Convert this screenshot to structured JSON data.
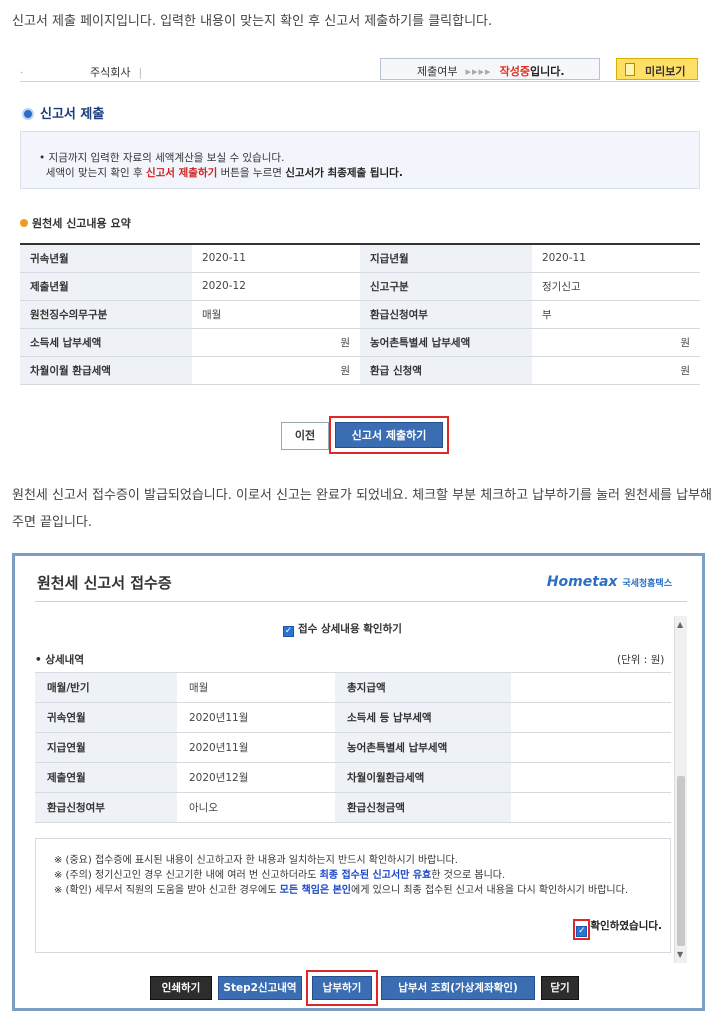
{
  "intro_text": "신고서 제출 페이지입니다. 입력한 내용이 맞는지 확인 후 신고서 제출하기를 클릭합니다.",
  "topbar": {
    "dot": ".",
    "company": "주식회사",
    "company_sep": "|",
    "status_label": "제출여부",
    "status_arrows": "▸▸▸▸",
    "status_value": "작성중",
    "status_suffix": "입니다.",
    "preview_label": "미리보기"
  },
  "section_title": "신고서 제출",
  "info": {
    "line1": "• 지금까지 입력한 자료의 세액계산을 보실 수 있습니다.",
    "line2_a": "세액이 맞는지 확인 후 ",
    "line2_red": "신고서 제출하기",
    "line2_b": " 버튼을 누르면 ",
    "line2_bold": "신고서가 최종제출 됩니다."
  },
  "summary_title": "원천세 신고내용 요약",
  "summary_rows": [
    {
      "l1": "귀속년월",
      "v1": "2020-11",
      "l2": "지급년월",
      "v2": "2020-11"
    },
    {
      "l1": "제출년월",
      "v1": "2020-12",
      "l2": "신고구분",
      "v2": "정기신고"
    },
    {
      "l1": "원천징수의무구분",
      "v1": "매월",
      "l2": "환급신청여부",
      "v2": "부"
    },
    {
      "l1": "소득세 납부세액",
      "v1": "원",
      "l2": "농어촌특별세 납부세액",
      "v2": "원"
    },
    {
      "l1": "차월이월 환급세액",
      "v1": "원",
      "l2": "환급 신청액",
      "v2": "원"
    }
  ],
  "buttons": {
    "prev": "이전",
    "submit": "신고서 제출하기"
  },
  "para2": "원천세 신고서 접수증이 발급되었습니다. 이로서 신고는 완료가 되었네요. 체크할 부분 체크하고 납부하기를 눌러 원천세를 납부해주면 끝입니다.",
  "receipt": {
    "title": "원천세 신고서 접수증",
    "logo": "Hometax",
    "logo_sub": "국세청홈택스",
    "check_all": "접수 상세내용 확인하기",
    "detail_label": "• 상세내역",
    "unit": "(단위 : 원)",
    "rows": [
      {
        "l1": "매월/반기",
        "v1": "매월",
        "l2": "총지급액",
        "v2": ""
      },
      {
        "l1": "귀속연월",
        "v1": "2020년11월",
        "l2": "소득세 등 납부세액",
        "v2": ""
      },
      {
        "l1": "지급연월",
        "v1": "2020년11월",
        "l2": "농어촌특별세 납부세액",
        "v2": ""
      },
      {
        "l1": "제출연월",
        "v1": "2020년12월",
        "l2": "차월이월환급세액",
        "v2": ""
      },
      {
        "l1": "환급신청여부",
        "v1": "아니오",
        "l2": "환급신청금액",
        "v2": ""
      }
    ],
    "notice": {
      "n1": "※ (중요) 접수증에 표시된 내용이 신고하고자 한 내용과 일치하는지 반드시 확인하시기 바랍니다.",
      "n2_a": "※ (주의) 정기신고인 경우 신고기한 내에 여러 번 신고하더라도 ",
      "n2_blue": "최종 접수된 신고서만 유효",
      "n2_b": "한 것으로 봅니다.",
      "n3_a": "※ (확인) 세무서 직원의 도움을 받아 신고한 경우에도 ",
      "n3_blue": "모든 책임은 본인",
      "n3_b": "에게 있으니 최종 접수된 신고서 내용을 다시 확인하시기 바랍니다.",
      "confirm": "확인하였습니다."
    },
    "actions": {
      "print": "인쇄하기",
      "step2": "Step2신고내역",
      "pay": "납부하기",
      "bill": "납부서 조회(가상계좌확인)",
      "close": "닫기"
    }
  }
}
